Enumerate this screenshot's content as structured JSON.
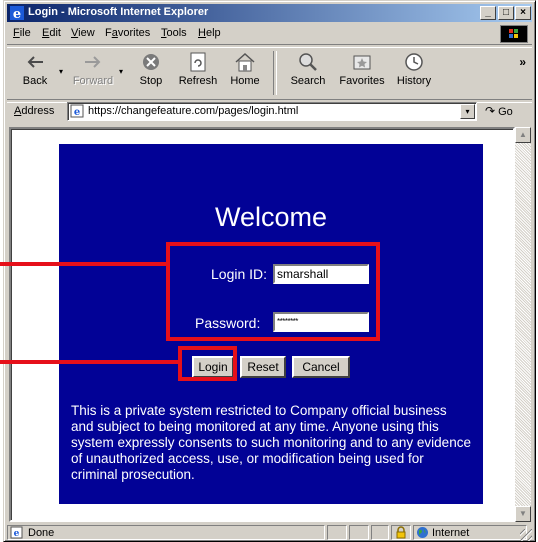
{
  "window": {
    "title": "Login - Microsoft Internet Explorer",
    "buttons": {
      "minimize": "_",
      "maximize": "□",
      "close": "×"
    }
  },
  "menu": {
    "items": [
      {
        "key": "F",
        "rest": "ile"
      },
      {
        "key": "E",
        "rest": "dit"
      },
      {
        "key": "V",
        "rest": "iew"
      },
      {
        "key": "F",
        "rest": "avorites",
        "prefix": "F",
        "label": "Favorites"
      },
      {
        "key": "T",
        "rest": "ools"
      },
      {
        "key": "H",
        "rest": "elp"
      }
    ]
  },
  "toolbar": {
    "back": "Back",
    "forward": "Forward",
    "stop": "Stop",
    "refresh": "Refresh",
    "home": "Home",
    "search": "Search",
    "favorites": "Favorites",
    "history": "History",
    "chevron": "»",
    "dropdown": "▾"
  },
  "address": {
    "label_key": "A",
    "label_rest": "ddress",
    "url": "https://changefeature.com/pages/login.html",
    "go": "Go",
    "go_arrow": "↷"
  },
  "page": {
    "welcome": "Welcome",
    "login_id_label": "Login ID:",
    "login_id_value": "smarshall",
    "password_label": "Password:",
    "password_value": "********",
    "buttons": {
      "login": "Login",
      "reset": "Reset",
      "cancel": "Cancel"
    },
    "notice": "This is a private system restricted to Company official business and subject to being monitored at any time. Anyone using this system expressly consents to such monitoring and to any evidence of unauthorized access, use, or modification being used for criminal prosecution."
  },
  "status": {
    "text": "Done",
    "zone": "Internet"
  },
  "colors": {
    "panel": "#020296",
    "highlight": "#e6101a",
    "chrome": "#d4d0c8",
    "titlebar_start": "#0a246a"
  },
  "icons": [
    "ie-logo-icon",
    "back-icon",
    "forward-icon",
    "stop-icon",
    "refresh-icon",
    "home-icon",
    "search-icon",
    "favorites-icon",
    "history-icon",
    "page-icon",
    "go-icon",
    "lock-icon",
    "globe-icon",
    "windows-logo-icon"
  ]
}
